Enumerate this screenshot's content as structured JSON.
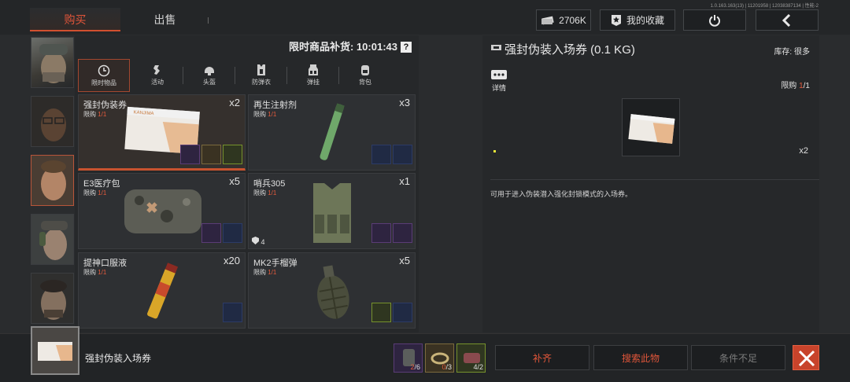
{
  "version": "1.0.163.163(13) | 11201958 | 12038387134 | 性能-2",
  "tabs": {
    "buy": "购买",
    "sell": "出售"
  },
  "topbar": {
    "currency": "2706K",
    "favorites": "我的收藏",
    "power_icon": "power-icon",
    "back_icon": "chevron-left-icon"
  },
  "shop": {
    "restock": "限时商品补货: 10:01:43",
    "help": "?",
    "categories": [
      {
        "label": "限时物品",
        "icon": "clock-icon"
      },
      {
        "label": "活动",
        "icon": "event-icon"
      },
      {
        "label": "头盔",
        "icon": "helmet-icon"
      },
      {
        "label": "防弹衣",
        "icon": "vest-icon"
      },
      {
        "label": "弹挂",
        "icon": "rig-icon"
      },
      {
        "label": "背包",
        "icon": "backpack-icon"
      }
    ],
    "limit_label": "限购",
    "items": [
      {
        "name": "强封伪装券",
        "limit": "1/1",
        "count": "x2"
      },
      {
        "name": "再生注射剂",
        "limit": "1/1",
        "count": "x3"
      },
      {
        "name": "E3医疗包",
        "limit": "1/1",
        "count": "x5"
      },
      {
        "name": "哨兵305",
        "limit": "1/1",
        "count": "x1",
        "armor": "4"
      },
      {
        "name": "提神口服液",
        "limit": "1/1",
        "count": "x20"
      },
      {
        "name": "MK2手榴弹",
        "limit": "1/1",
        "count": "x5"
      }
    ]
  },
  "detail": {
    "title": "强封伪装入场券 (0.1 KG)",
    "stock": "库存:  很多",
    "info_label": "详情",
    "limit_label": "限购",
    "limit_num": "1",
    "limit_den": "/1",
    "quantity": "x2",
    "description": "可用于进入伪装潜入强化封锁模式的入场券。"
  },
  "bottom": {
    "name": "强封伪装入场券",
    "requirements": [
      {
        "have": "2",
        "need": "/6"
      },
      {
        "have": "0",
        "need": "/3"
      },
      {
        "have": "4",
        "need": "/2"
      }
    ],
    "fill_label": "补齐",
    "search_label": "搜索此物",
    "condition_label": "条件不足"
  },
  "colors": {
    "accent": "#e0563a",
    "panel": "#26282a",
    "background": "#2a2c2e"
  }
}
